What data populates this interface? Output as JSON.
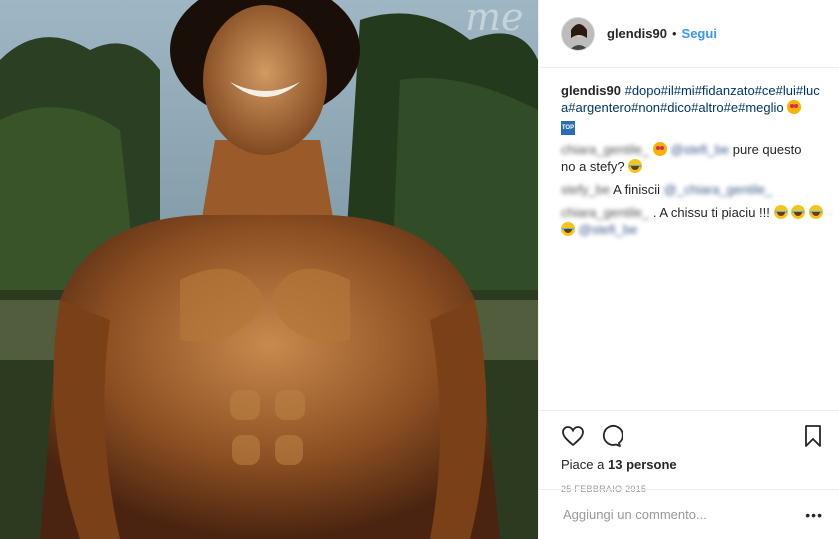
{
  "post": {
    "username": "glendis90",
    "follow_label": "Segui",
    "separator": "•"
  },
  "caption": {
    "username": "glendis90",
    "hashtags_line1": "#dopo#il#mi#fidanzato#ce#lui#luc",
    "hashtags_line2": "a#argentero#non#dico#altro#e#meglio",
    "emoji": "heart-eyes",
    "badge_text": "TOP"
  },
  "comments": [
    {
      "user": "chiara_gentile_",
      "mention": "@stefi_be",
      "text_a": "pure questo",
      "text_b": "no a stefy?",
      "emojis": [
        "heart-eyes",
        "tears-of-joy"
      ]
    },
    {
      "user": "stefy_be",
      "text": "A finiscii",
      "mention": "@_chiara_gentile_"
    },
    {
      "user": "chiara_gentile_",
      "text": ". A chissu ti piaciu !!!",
      "mention": "@stefi_be",
      "emojis": [
        "tears-of-joy",
        "tears-of-joy",
        "tears-of-joy",
        "tears-of-joy"
      ]
    }
  ],
  "actions": {
    "like_icon": "heart-icon",
    "comment_icon": "comment-icon",
    "save_icon": "bookmark-icon"
  },
  "likes": {
    "prefix": "Piace a",
    "count": "13 persone"
  },
  "date": "25 FEBBRAIO 2015",
  "add_comment": {
    "placeholder": "Aggiungi un commento...",
    "more_label": "•••"
  },
  "colors": {
    "link": "#3897f0",
    "hashtag": "#003569",
    "border": "#efefef"
  }
}
